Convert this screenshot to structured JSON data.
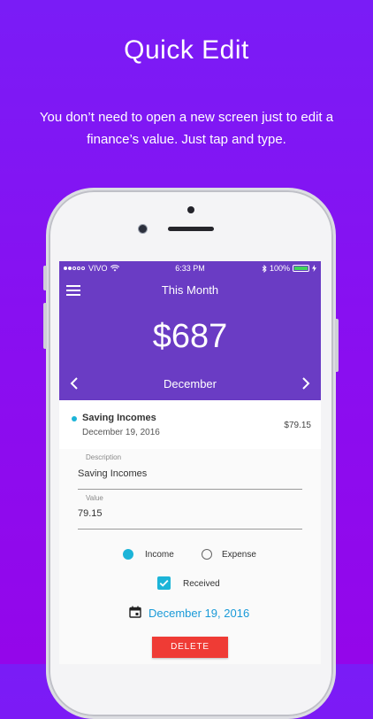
{
  "promo": {
    "headline": "Quick Edit",
    "subtext": "You don’t need to open a new screen just to edit a finance’s value. Just tap and type."
  },
  "status_bar": {
    "carrier": "VIVO",
    "time": "6:33 PM",
    "battery": "100%"
  },
  "header": {
    "title": "This Month",
    "amount": "$687",
    "month": "December"
  },
  "record": {
    "title": "Saving Incomes",
    "date": "December 19, 2016",
    "value": "$79.15"
  },
  "form": {
    "description_label": "Description",
    "description_value": "Saving Incomes",
    "value_label": "Value",
    "value_value": "79.15",
    "type_options": [
      "Income",
      "Expense"
    ],
    "selected_type": "Income",
    "received_label": "Received",
    "received_checked": true,
    "date": "December 19, 2016",
    "delete_label": "DELETE"
  },
  "colors": {
    "header": "#6a3cc4",
    "accent": "#1cb4d8",
    "delete": "#ef3b35",
    "date_link": "#1a9ad8"
  },
  "icons": [
    "menu-icon",
    "wifi-icon",
    "bluetooth-icon",
    "battery-icon",
    "chevron-left-icon",
    "chevron-right-icon",
    "calendar-icon",
    "check-icon"
  ]
}
